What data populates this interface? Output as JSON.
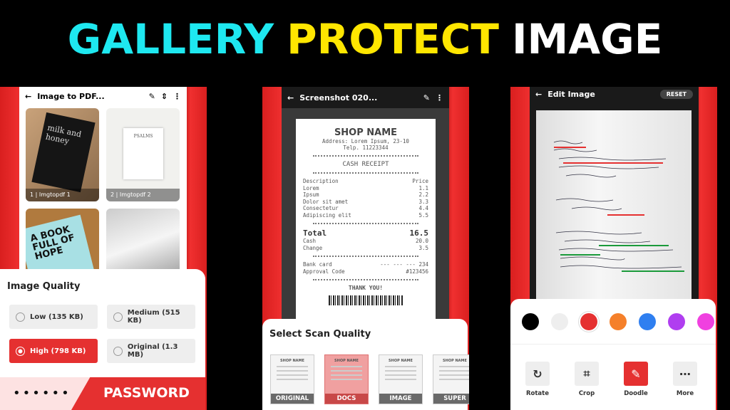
{
  "headline": {
    "words": [
      "GALLERY",
      "PROTECT",
      "IMAGE"
    ],
    "colors": [
      "#1ee8f0",
      "#ffe600",
      "#ffffff"
    ]
  },
  "panel1": {
    "title": "Image to PDF...",
    "thumbs": [
      {
        "index": "1",
        "name": "Imgtopdf 1",
        "text": "milk and honey"
      },
      {
        "index": "2",
        "name": "Imgtopdf 2",
        "text": "PSALMS"
      },
      {
        "text": "A BOOK FULL OF HOPE"
      },
      {
        "text": ""
      }
    ],
    "sheet_title": "Image Quality",
    "options": [
      {
        "label": "Low (135 KB)",
        "selected": false
      },
      {
        "label": "Medium (515 KB)",
        "selected": false
      },
      {
        "label": "High (798 KB)",
        "selected": true
      },
      {
        "label": "Original (1.3 MB)",
        "selected": false
      }
    ],
    "password_dots": "••••••",
    "password_label": "PASSWORD"
  },
  "panel2": {
    "title": "Screenshot 020...",
    "receipt": {
      "shop": "SHOP NAME",
      "address": "Address: Lorem Ipsum, 23-10",
      "phone": "Telp. 11223344",
      "heading": "CASH RECEIPT",
      "desc": "Description",
      "price": "Price",
      "items": [
        [
          "Lorem",
          "1.1"
        ],
        [
          "Ipsum",
          "2.2"
        ],
        [
          "Dolor sit amet",
          "3.3"
        ],
        [
          "Consectetur",
          "4.4"
        ],
        [
          "Adipiscing elit",
          "5.5"
        ]
      ],
      "total_label": "Total",
      "total": "16.5",
      "cash_label": "Cash",
      "cash": "20.0",
      "change_label": "Change",
      "change": "3.5",
      "bank_label": "Bank card",
      "bank": "--- --- --- 234",
      "approval_label": "Approval Code",
      "approval": "#123456",
      "thanks": "THANK YOU!"
    },
    "sheet_title": "Select Scan Quality",
    "qualities": [
      "ORIGINAL",
      "DOCS",
      "IMAGE",
      "SUPER"
    ],
    "selected": "DOCS"
  },
  "panel3": {
    "title": "Edit Image",
    "reset": "RESET",
    "colors": [
      "#000000",
      "#eeeeee",
      "#e53030",
      "#f5802a",
      "#2f7ff0",
      "#b03ef0",
      "#f040e0"
    ],
    "selected_color": "#e53030",
    "tools": [
      {
        "label": "Rotate",
        "icon": "rotate-icon"
      },
      {
        "label": "Crop",
        "icon": "crop-icon"
      },
      {
        "label": "Doodle",
        "icon": "brush-icon",
        "active": true
      },
      {
        "label": "More",
        "icon": "more-icon"
      }
    ]
  },
  "accent": "#e53030"
}
